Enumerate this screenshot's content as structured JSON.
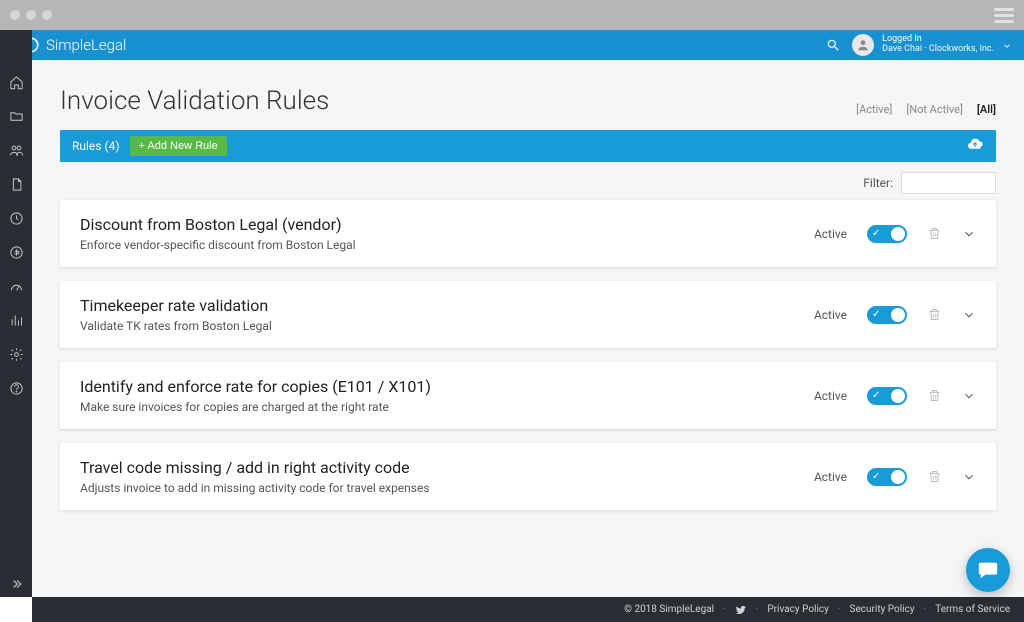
{
  "brand": {
    "name": "SimpleLegal"
  },
  "header": {
    "logged_in_label": "Logged In",
    "user_line": "Dave Chai · Clockworks, Inc."
  },
  "page": {
    "title": "Invoice Validation Rules",
    "filters": {
      "active": "[Active]",
      "not_active": "[Not Active]",
      "all": "[All]"
    }
  },
  "rules_bar": {
    "count_label": "Rules (4)",
    "add_button": "+ Add New Rule"
  },
  "filter_row": {
    "label": "Filter:",
    "value": ""
  },
  "status_label": "Active",
  "rules": [
    {
      "title": "Discount from Boston Legal (vendor)",
      "desc": "Enforce vendor-specific discount from Boston Legal",
      "active": true
    },
    {
      "title": "Timekeeper rate validation",
      "desc": "Validate TK rates from Boston Legal",
      "active": true
    },
    {
      "title": "Identify and enforce rate for copies (E101 / X101)",
      "desc": "Make sure invoices for copies are charged at the right rate",
      "active": true
    },
    {
      "title": "Travel code missing / add in right activity code",
      "desc": "Adjusts invoice to add in missing activity code for travel expenses",
      "active": true
    }
  ],
  "footer": {
    "copyright": "© 2018 SimpleLegal",
    "privacy": "Privacy Policy",
    "security": "Security Policy",
    "terms": "Terms of Service"
  }
}
